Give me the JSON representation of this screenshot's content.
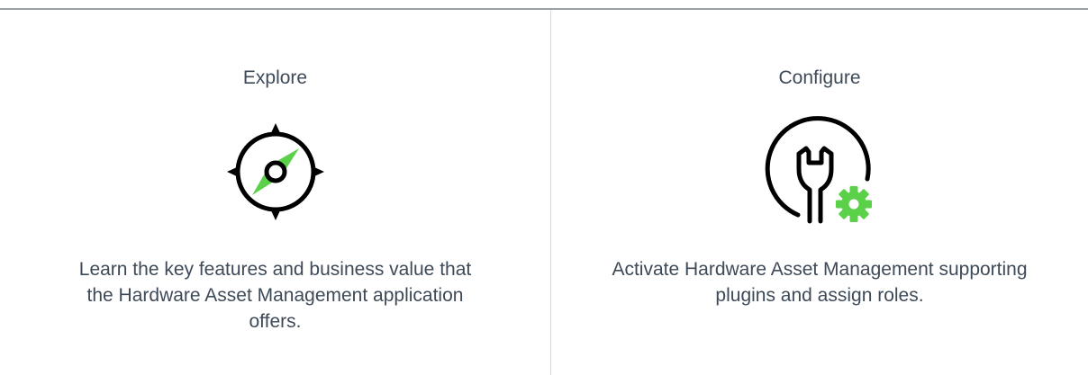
{
  "cards": [
    {
      "title": "Explore",
      "icon": "compass-icon",
      "description": "Learn the key features and business value that the Hardware Asset Management application offers."
    },
    {
      "title": "Configure",
      "icon": "wrench-gear-icon",
      "description": "Activate Hardware Asset Management supporting plugins and assign roles."
    }
  ],
  "colors": {
    "accent_green": "#5bd14a",
    "icon_stroke": "#000000",
    "text": "#3e4a58"
  }
}
